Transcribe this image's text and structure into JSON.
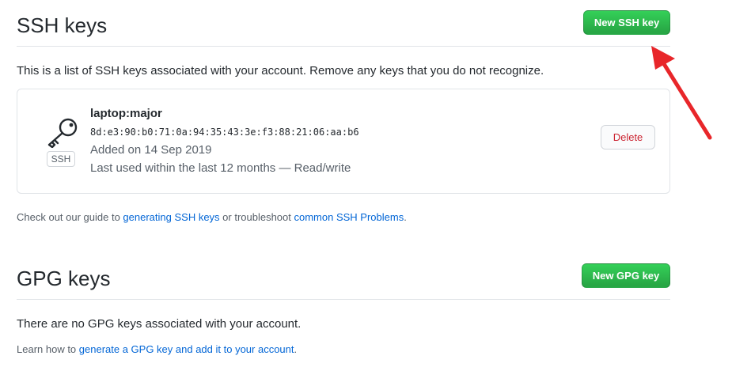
{
  "ssh": {
    "title": "SSH keys",
    "new_button": "New SSH key",
    "description": "This is a list of SSH keys associated with your account. Remove any keys that you do not recognize.",
    "keys": [
      {
        "badge": "SSH",
        "title": "laptop:major",
        "fingerprint": "8d:e3:90:b0:71:0a:94:35:43:3e:f3:88:21:06:aa:b6",
        "added": "Added on 14 Sep 2019",
        "last_used": "Last used within the last 12 months — Read/write",
        "delete_label": "Delete"
      }
    ],
    "guide": {
      "prefix": "Check out our guide to ",
      "link1": "generating SSH keys",
      "middle": " or troubleshoot ",
      "link2": "common SSH Problems",
      "suffix": "."
    }
  },
  "gpg": {
    "title": "GPG keys",
    "new_button": "New GPG key",
    "empty_message": "There are no GPG keys associated with your account.",
    "learn": {
      "prefix": "Learn how to ",
      "link": "generate a GPG key and add it to your account",
      "suffix": "."
    }
  },
  "annotation": {
    "arrow_color": "#e8262a"
  },
  "icons": {
    "key": "key-icon"
  }
}
